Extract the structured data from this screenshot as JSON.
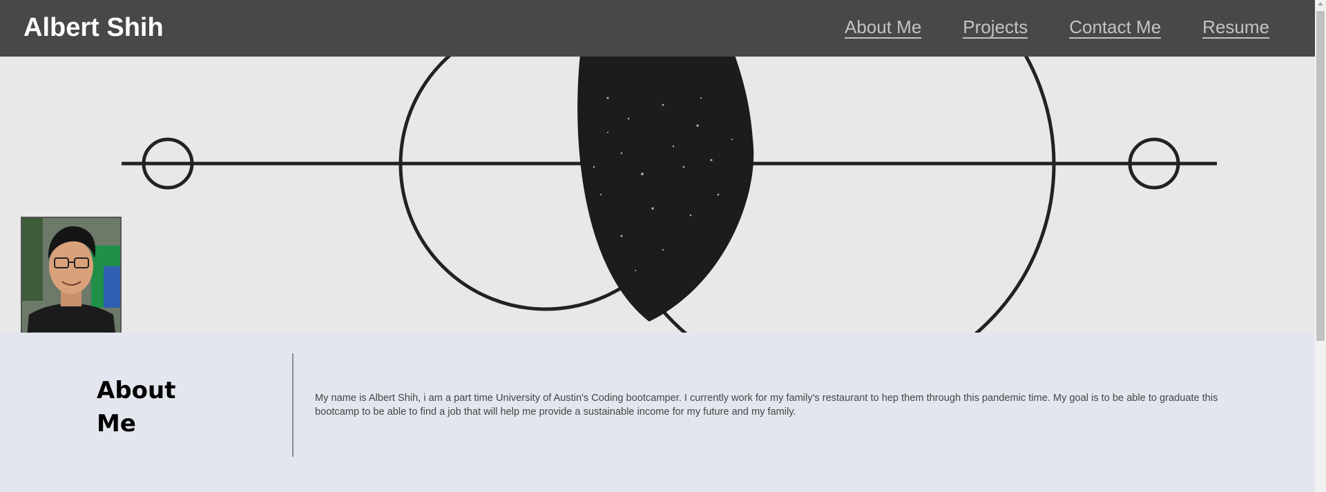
{
  "header": {
    "title": "Albert Shih",
    "nav": [
      {
        "label": "About Me"
      },
      {
        "label": "Projects"
      },
      {
        "label": "Contact Me"
      },
      {
        "label": "Resume"
      }
    ]
  },
  "hero": {
    "background_image": "geometric-circles-eclipse",
    "profile_photo": "profile-photo"
  },
  "about": {
    "heading": "About Me",
    "body": "My name is Albert Shih, i am a part time University of Austin's Coding bootcamper. I currently work for my family's restaurant to hep them through this pandemic time. My goal is to be able to graduate this bootcamp to be able to find a job that will help me provide a sustainable income for my future and my family."
  },
  "colors": {
    "navbar": "#484848",
    "nav_link": "#c4c4c4",
    "hero_bg": "#e8e8e8",
    "about_bg": "#e3e6ee",
    "line": "#222222"
  }
}
